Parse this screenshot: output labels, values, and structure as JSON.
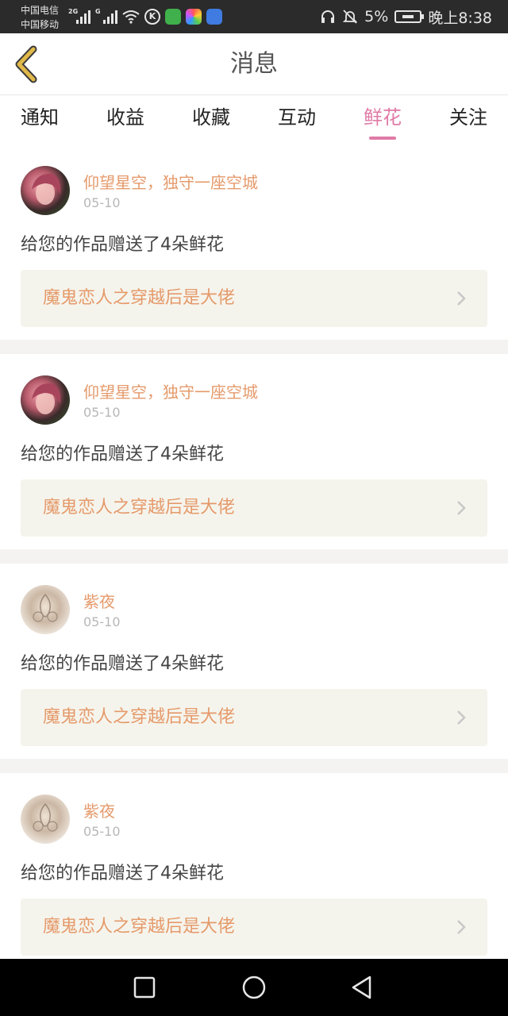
{
  "status_bar": {
    "carrier1": "中国电信",
    "carrier2": "中国移动",
    "sig1_tag": "2G",
    "sig2_tag": "G",
    "battery": "5%",
    "time": "晚上8:38"
  },
  "header": {
    "title": "消息"
  },
  "tabs": [
    {
      "label": "通知",
      "active": false
    },
    {
      "label": "收益",
      "active": false
    },
    {
      "label": "收藏",
      "active": false
    },
    {
      "label": "互动",
      "active": false
    },
    {
      "label": "鲜花",
      "active": true
    },
    {
      "label": "关注",
      "active": false
    }
  ],
  "feed": [
    {
      "user": "仰望星空，独守一座空城",
      "date": "05-10",
      "message": "给您的作品赠送了4朵鲜花",
      "work": "魔鬼恋人之穿越后是大佬"
    },
    {
      "user": "仰望星空，独守一座空城",
      "date": "05-10",
      "message": "给您的作品赠送了4朵鲜花",
      "work": "魔鬼恋人之穿越后是大佬"
    },
    {
      "user": "紫夜",
      "date": "05-10",
      "message": "给您的作品赠送了4朵鲜花",
      "work": "魔鬼恋人之穿越后是大佬"
    },
    {
      "user": "紫夜",
      "date": "05-10",
      "message": "给您的作品赠送了4朵鲜花",
      "work": "魔鬼恋人之穿越后是大佬"
    }
  ],
  "colors": {
    "accent_pink": "#e07aa6",
    "name_orange": "#e59a6b",
    "back_gold": "#e0b84a"
  }
}
